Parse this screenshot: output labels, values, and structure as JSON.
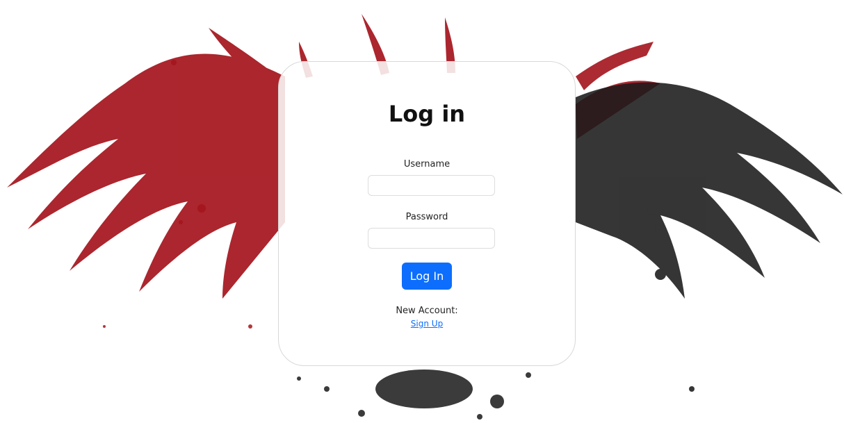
{
  "login": {
    "title": "Log in",
    "username_label": "Username",
    "username_value": "",
    "password_label": "Password",
    "password_value": "",
    "submit_label": "Log In",
    "new_account_text": "New Account:",
    "signup_link": "Sign Up"
  },
  "background": {
    "art": "eagle-splatter-illustration",
    "colors": {
      "red": "#a4141c",
      "dark": "#1a1a1a"
    }
  },
  "colors": {
    "accent": "#0d6efd"
  }
}
